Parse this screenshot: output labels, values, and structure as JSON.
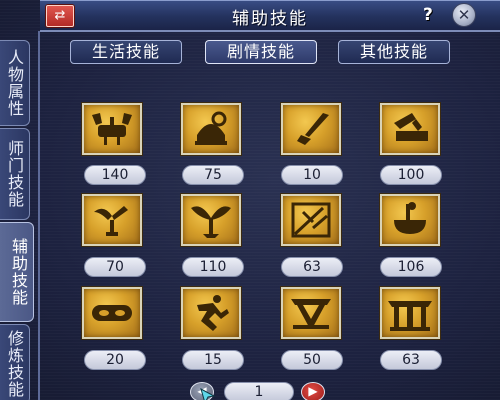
{
  "window": {
    "title": "辅助技能",
    "menu_icon": "swap-arrows-icon",
    "help_label": "?",
    "close_label": "✕"
  },
  "side_tabs": [
    {
      "label": "人物属性",
      "active": false
    },
    {
      "label": "师门技能",
      "active": false
    },
    {
      "label": "辅助技能",
      "active": true
    },
    {
      "label": "修炼技能",
      "active": false
    }
  ],
  "categories": [
    {
      "label": "生活技能",
      "active": false
    },
    {
      "label": "剧情技能",
      "active": true
    },
    {
      "label": "其他技能",
      "active": false
    }
  ],
  "skills": [
    {
      "icon": "crab-icon",
      "level": "140"
    },
    {
      "icon": "fish-bowl-icon",
      "level": "75"
    },
    {
      "icon": "dagger-icon",
      "level": "10"
    },
    {
      "icon": "hammer-icon",
      "level": "100"
    },
    {
      "icon": "scissors-icon",
      "level": "70"
    },
    {
      "icon": "sprout-icon",
      "level": "110"
    },
    {
      "icon": "broken-frame-icon",
      "level": "63"
    },
    {
      "icon": "mortar-icon",
      "level": "106"
    },
    {
      "icon": "mask-icon",
      "level": "20"
    },
    {
      "icon": "runner-icon",
      "level": "15"
    },
    {
      "icon": "gate-icon",
      "level": "50"
    },
    {
      "icon": "temple-icon",
      "level": "63"
    }
  ],
  "pager": {
    "page": "1",
    "prev_icon": "chevron-left-icon",
    "next_icon": "chevron-right-icon"
  },
  "colors": {
    "title_bar": "#2a3a6e",
    "skill_gold": "#d7a02a",
    "level_pill": "#d5d9e6"
  }
}
